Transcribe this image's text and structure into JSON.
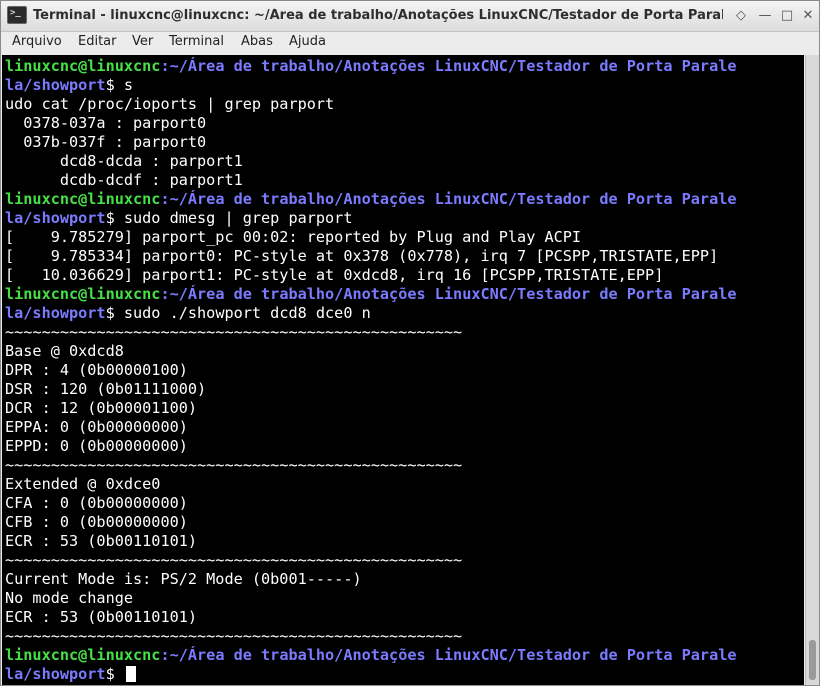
{
  "window": {
    "title": "Terminal - linuxcnc@linuxcnc: ~/Área de trabalho/Anotações LinuxCNC/Testador de Porta Paralela/showport",
    "buttons": {
      "top": "◇",
      "minimize": "—",
      "maximize": "□",
      "close": "✕"
    }
  },
  "menu": [
    "Arquivo",
    "Editar",
    "Ver",
    "Terminal",
    "Abas",
    "Ajuda"
  ],
  "terminal": {
    "lines": [
      {
        "type": "prompt_a",
        "user": "linuxcnc@linuxcnc",
        "path": ":~/Área de trabalho/Anotações LinuxCNC/Testador de Porta Parale"
      },
      {
        "type": "prompt_b",
        "path": "la/showport",
        "cmd": "$ s"
      },
      {
        "type": "text",
        "text": "udo cat /proc/ioports | grep parport"
      },
      {
        "type": "text",
        "text": "  0378-037a : parport0"
      },
      {
        "type": "text",
        "text": "  037b-037f : parport0"
      },
      {
        "type": "text",
        "text": "      dcd8-dcda : parport1"
      },
      {
        "type": "text",
        "text": "      dcdb-dcdf : parport1"
      },
      {
        "type": "prompt_a",
        "user": "linuxcnc@linuxcnc",
        "path": ":~/Área de trabalho/Anotações LinuxCNC/Testador de Porta Parale"
      },
      {
        "type": "prompt_b",
        "path": "la/showport",
        "cmd": "$ sudo dmesg | grep parport"
      },
      {
        "type": "text",
        "text": "[    9.785279] parport_pc 00:02: reported by Plug and Play ACPI"
      },
      {
        "type": "text",
        "text": "[    9.785334] parport0: PC-style at 0x378 (0x778), irq 7 [PCSPP,TRISTATE,EPP]"
      },
      {
        "type": "text",
        "text": "[   10.036629] parport1: PC-style at 0xdcd8, irq 16 [PCSPP,TRISTATE,EPP]"
      },
      {
        "type": "prompt_a",
        "user": "linuxcnc@linuxcnc",
        "path": ":~/Área de trabalho/Anotações LinuxCNC/Testador de Porta Parale"
      },
      {
        "type": "prompt_b",
        "path": "la/showport",
        "cmd": "$ sudo ./showport dcd8 dce0 n"
      },
      {
        "type": "text",
        "text": "~~~~~~~~~~~~~~~~~~~~~~~~~~~~~~~~~~~~~~~~~~~~~~~~~~"
      },
      {
        "type": "text",
        "text": "Base @ 0xdcd8"
      },
      {
        "type": "text",
        "text": "DPR : 4 (0b00000100)"
      },
      {
        "type": "text",
        "text": "DSR : 120 (0b01111000)"
      },
      {
        "type": "text",
        "text": "DCR : 12 (0b00001100)"
      },
      {
        "type": "text",
        "text": "EPPA: 0 (0b00000000)"
      },
      {
        "type": "text",
        "text": "EPPD: 0 (0b00000000)"
      },
      {
        "type": "text",
        "text": "~~~~~~~~~~~~~~~~~~~~~~~~~~~~~~~~~~~~~~~~~~~~~~~~~~"
      },
      {
        "type": "text",
        "text": "Extended @ 0xdce0"
      },
      {
        "type": "text",
        "text": "CFA : 0 (0b00000000)"
      },
      {
        "type": "text",
        "text": "CFB : 0 (0b00000000)"
      },
      {
        "type": "text",
        "text": "ECR : 53 (0b00110101)"
      },
      {
        "type": "text",
        "text": "~~~~~~~~~~~~~~~~~~~~~~~~~~~~~~~~~~~~~~~~~~~~~~~~~~"
      },
      {
        "type": "text",
        "text": "Current Mode is: PS/2 Mode (0b001-----)"
      },
      {
        "type": "text",
        "text": "No mode change"
      },
      {
        "type": "text",
        "text": "ECR : 53 (0b00110101)"
      },
      {
        "type": "text",
        "text": "~~~~~~~~~~~~~~~~~~~~~~~~~~~~~~~~~~~~~~~~~~~~~~~~~~"
      },
      {
        "type": "prompt_a",
        "user": "linuxcnc@linuxcnc",
        "path": ":~/Área de trabalho/Anotações LinuxCNC/Testador de Porta Parale"
      },
      {
        "type": "prompt_b",
        "path": "la/showport",
        "cmd": "$ ",
        "cursor": true
      }
    ]
  },
  "colors": {
    "background": "#000000",
    "text": "#ffffff",
    "prompt_user": "#46e046",
    "prompt_path": "#7b7bff"
  }
}
